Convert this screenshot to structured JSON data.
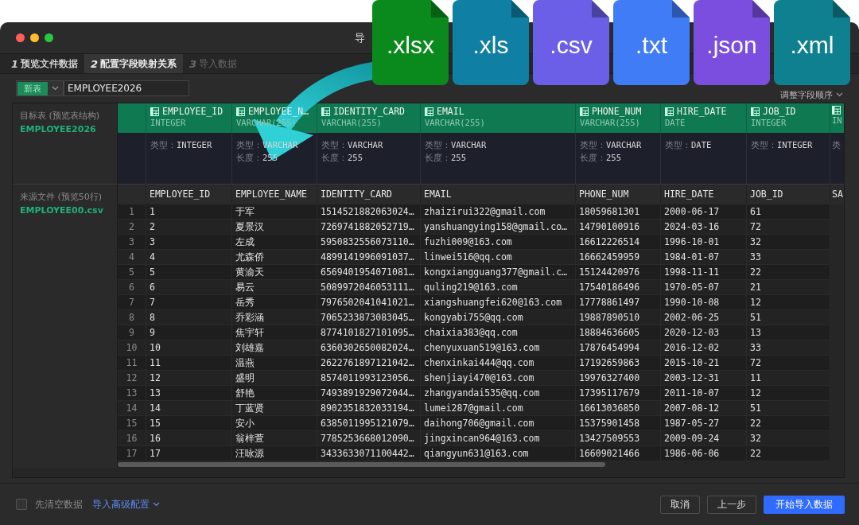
{
  "window": {
    "title": "导"
  },
  "tabs": [
    {
      "number": "1",
      "label": "预览文件数据",
      "selected": false,
      "disabled": false
    },
    {
      "number": "2",
      "label": "配置字段映射关系",
      "selected": true,
      "disabled": false
    },
    {
      "number": "3",
      "label": "导入数据",
      "selected": false,
      "disabled": true
    }
  ],
  "toolbar": {
    "table_mode": "新表",
    "table_name": "EMPLOYEE2026",
    "reorder_label": "调整字段顺序"
  },
  "target": {
    "label": "目标表 (预览表结构)",
    "name": "EMPLOYEE2026",
    "columns": [
      {
        "name": "EMPLOYEE_ID",
        "type": "INTEGER",
        "details": [
          {
            "label": "类型：",
            "value": "INTEGER"
          }
        ]
      },
      {
        "name": "EMPLOYEE_N…",
        "type": "VARCHAR(255)",
        "details": [
          {
            "label": "类型：",
            "value": "VARCHAR"
          },
          {
            "label": "长度：",
            "value": "255"
          }
        ]
      },
      {
        "name": "IDENTITY_CARD",
        "type": "VARCHAR(255)",
        "details": [
          {
            "label": "类型：",
            "value": "VARCHAR"
          },
          {
            "label": "长度：",
            "value": "255"
          }
        ]
      },
      {
        "name": "EMAIL",
        "type": "VARCHAR(255)",
        "details": [
          {
            "label": "类型：",
            "value": "VARCHAR"
          },
          {
            "label": "长度：",
            "value": "255"
          }
        ]
      },
      {
        "name": "PHONE_NUM",
        "type": "VARCHAR(255)",
        "details": [
          {
            "label": "类型：",
            "value": "VARCHAR"
          },
          {
            "label": "长度：",
            "value": "255"
          }
        ]
      },
      {
        "name": "HIRE_DATE",
        "type": "DATE",
        "details": [
          {
            "label": "类型：",
            "value": "DATE"
          }
        ]
      },
      {
        "name": "JOB_ID",
        "type": "INTEGER",
        "details": [
          {
            "label": "类型：",
            "value": "INTEGER"
          }
        ]
      },
      {
        "type": "IN",
        "details": [
          {
            "label": "类"
          }
        ]
      }
    ]
  },
  "source": {
    "label": "来源文件 (预览50行)",
    "file": "EMPLOYEE00.csv",
    "columns": [
      "EMPLOYEE_ID",
      "EMPLOYEE_NAME",
      "IDENTITY_CARD",
      "EMAIL",
      "PHONE_NUM",
      "HIRE_DATE",
      "JOB_ID",
      "SA"
    ],
    "rows": [
      {
        "number": "1",
        "cells": [
          "1",
          "于军",
          "1514521882063024…",
          "zhaizirui322@gmail.com",
          "18059681301",
          "2000-06-17",
          "61"
        ]
      },
      {
        "number": "2",
        "cells": [
          "2",
          "夏景汉",
          "7269741882052719…",
          "yanshuangying158@gmail.co…",
          "14790100916",
          "2024-03-16",
          "72"
        ]
      },
      {
        "number": "3",
        "cells": [
          "3",
          "左成",
          "5950832556073110…",
          "fuzhi009@163.com",
          "16612226514",
          "1996-10-01",
          "32"
        ]
      },
      {
        "number": "4",
        "cells": [
          "4",
          "尤森侨",
          "4899141996091037…",
          "linwei516@qq.com",
          "16662459959",
          "1984-01-07",
          "33"
        ]
      },
      {
        "number": "5",
        "cells": [
          "5",
          "黄渝天",
          "6569401954071081…",
          "kongxiangguang377@gmail.c…",
          "15124420976",
          "1998-11-11",
          "22"
        ]
      },
      {
        "number": "6",
        "cells": [
          "6",
          "易云",
          "5089972046053111…",
          "quling219@163.com",
          "17540186496",
          "1970-05-07",
          "21"
        ]
      },
      {
        "number": "7",
        "cells": [
          "7",
          "岳秀",
          "7976502041041021…",
          "xiangshuangfei620@163.com",
          "17778861497",
          "1990-10-08",
          "12"
        ]
      },
      {
        "number": "8",
        "cells": [
          "8",
          "乔彩涵",
          "7065233873083045…",
          "kongyabi755@qq.com",
          "19887890510",
          "2002-06-25",
          "51"
        ]
      },
      {
        "number": "9",
        "cells": [
          "9",
          "焦宇轩",
          "8774101827101095…",
          "chaixia383@qq.com",
          "18884636605",
          "2020-12-03",
          "13"
        ]
      },
      {
        "number": "10",
        "cells": [
          "10",
          "刘雄嘉",
          "6360302650082024…",
          "chenyuxuan519@163.com",
          "17876454994",
          "2016-12-02",
          "33"
        ]
      },
      {
        "number": "11",
        "cells": [
          "11",
          "温燕",
          "2622761897121042…",
          "chenxinkai444@qq.com",
          "17192659863",
          "2015-10-21",
          "72"
        ]
      },
      {
        "number": "12",
        "cells": [
          "12",
          "盛明",
          "8574011993123056…",
          "shenjiayi470@163.com",
          "19976327400",
          "2003-12-31",
          "11"
        ]
      },
      {
        "number": "13",
        "cells": [
          "13",
          "舒艳",
          "7493891929072044…",
          "zhangyandai535@qq.com",
          "17395117679",
          "2011-10-07",
          "12"
        ]
      },
      {
        "number": "14",
        "cells": [
          "14",
          "丁蓝贤",
          "8902351832033194…",
          "lumei287@gmail.com",
          "16613036850",
          "2007-08-12",
          "51"
        ]
      },
      {
        "number": "15",
        "cells": [
          "15",
          "安小",
          "6385011995121079…",
          "daihong706@gmail.com",
          "15375901458",
          "1987-05-27",
          "22"
        ]
      },
      {
        "number": "16",
        "cells": [
          "16",
          "翁梓萱",
          "7785253668012090…",
          "jingxincan964@163.com",
          "13427509553",
          "2009-09-24",
          "32"
        ]
      },
      {
        "number": "17",
        "cells": [
          "17",
          "汪咏源",
          "3433633071100442…",
          "qiangyun631@163.com",
          "16609021466",
          "1986-06-06",
          "22"
        ]
      }
    ]
  },
  "footer": {
    "clear_option": {
      "label": "先清空数据",
      "checked": false
    },
    "advanced_link": "导入高级配置",
    "buttons": [
      {
        "label": "取消",
        "kind": "secondary"
      },
      {
        "label": "上一步",
        "kind": "secondary"
      },
      {
        "label": "开始导入数据",
        "kind": "primary"
      }
    ]
  },
  "file_types": [
    {
      "label": ".xlsx",
      "color": "#0a8a1c"
    },
    {
      "label": ".xls",
      "color": "#0f7fa3"
    },
    {
      "label": ".csv",
      "color": "#6a5fe6"
    },
    {
      "label": ".txt",
      "color": "#407cf6"
    },
    {
      "label": ".json",
      "color": "#7b4ee0"
    },
    {
      "label": ".xml",
      "color": "#0f8090"
    }
  ]
}
